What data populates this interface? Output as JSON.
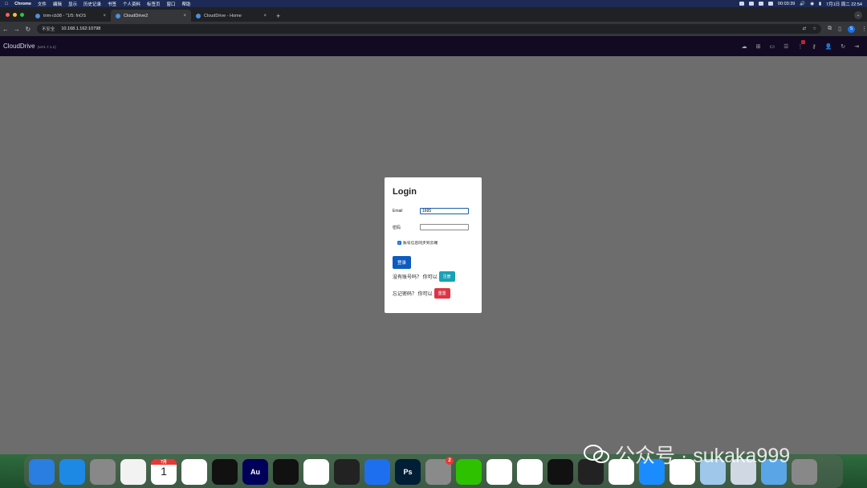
{
  "menubar": {
    "app": "Chrome",
    "items": [
      "文件",
      "编辑",
      "显示",
      "历史记录",
      "书签",
      "个人资料",
      "标签页",
      "窗口",
      "帮助"
    ],
    "timer": "00:03:39",
    "datetime": "7月1日 周二 22:54"
  },
  "tabs": [
    {
      "title": "trim-cb38 - \"1/5: fnOS",
      "active": false
    },
    {
      "title": "CloudDrive2",
      "active": true
    },
    {
      "title": "CloudDrive - Home",
      "active": false
    }
  ],
  "newtab": "+",
  "address": {
    "security": "不安全",
    "url": "10.168.1.162:10798"
  },
  "appbar": {
    "brand": "CloudDrive",
    "version": "(ver1.7.1.1)"
  },
  "login": {
    "title": "Login",
    "email_label": "Email",
    "email_value": "1695",
    "password_label": "密码",
    "password_value": "",
    "sync_label": "账号信息同步到云端",
    "sync_checked": true,
    "login_button": "登录",
    "no_account_text": "没有账号吗？ 你可以",
    "register_button": "注册",
    "forgot_text": "忘记密码？ 你可以",
    "reset_button": "重置"
  },
  "dock": {
    "calendar_month": "7月",
    "calendar_day": "1",
    "settings_badge": "2",
    "apps": [
      {
        "name": "finder",
        "color": "#2a7de1"
      },
      {
        "name": "safari",
        "color": "#1e88e5"
      },
      {
        "name": "launchpad",
        "color": "#888"
      },
      {
        "name": "reminders",
        "color": "#f2f2f2"
      },
      {
        "name": "calendar",
        "color": "#fff"
      },
      {
        "name": "chrome",
        "color": "#fff"
      },
      {
        "name": "capcut",
        "color": "#111"
      },
      {
        "name": "audition",
        "color": "#00005b",
        "label": "Au"
      },
      {
        "name": "capcut-2",
        "color": "#111"
      },
      {
        "name": "red-app",
        "color": "#fff"
      },
      {
        "name": "final-cut",
        "color": "#222"
      },
      {
        "name": "blue-app",
        "color": "#1e6ef0"
      },
      {
        "name": "photoshop",
        "color": "#001e36",
        "label": "Ps"
      },
      {
        "name": "system-settings",
        "color": "#8a8a8a"
      },
      {
        "name": "wechat",
        "color": "#2dc100"
      },
      {
        "name": "wps",
        "color": "#fff"
      },
      {
        "name": "teal-app",
        "color": "#fff"
      },
      {
        "name": "rec-app",
        "color": "#111"
      },
      {
        "name": "obs",
        "color": "#222"
      },
      {
        "name": "qq",
        "color": "#fff"
      },
      {
        "name": "app-store",
        "color": "#1a8cff"
      },
      {
        "name": "wps-2",
        "color": "#fff"
      },
      {
        "name": "photos",
        "color": "#9ec7ea"
      },
      {
        "name": "preview",
        "color": "#cfd8e3"
      },
      {
        "name": "folder",
        "color": "#5aa5e6"
      },
      {
        "name": "trash",
        "color": "#888"
      }
    ]
  },
  "watermark": "公众号 · sukaka999",
  "colors": {
    "login_button": "#0d5bbf",
    "register_button": "#17a2b8",
    "reset_button": "#dc3545",
    "backdrop": "#6d6d6d"
  }
}
